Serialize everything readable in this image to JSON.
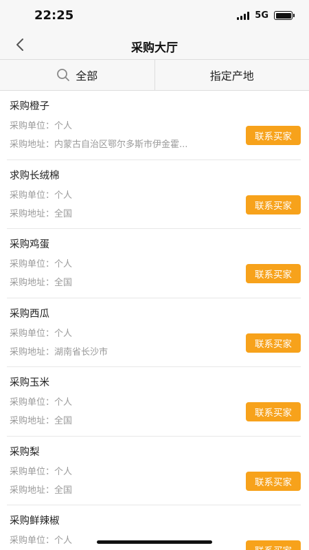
{
  "status": {
    "time": "22:25",
    "network": "5G"
  },
  "nav": {
    "title": "采购大厅",
    "back_icon": "chevron-left-icon"
  },
  "filters": {
    "all_label": "全部",
    "search_icon": "search-icon",
    "origin_label": "指定产地"
  },
  "items": [
    {
      "title": "采购橙子",
      "unit": "采购单位：个人",
      "address": "采购地址：内蒙古自治区鄂尔多斯市伊金霍...",
      "button": "联系买家"
    },
    {
      "title": "求购长绒棉",
      "unit": "采购单位：个人",
      "address": "采购地址：全国",
      "button": "联系买家"
    },
    {
      "title": "采购鸡蛋",
      "unit": "采购单位：个人",
      "address": "采购地址：全国",
      "button": "联系买家"
    },
    {
      "title": "采购西瓜",
      "unit": "采购单位：个人",
      "address": "采购地址：湖南省长沙市",
      "button": "联系买家"
    },
    {
      "title": "采购玉米",
      "unit": "采购单位：个人",
      "address": "采购地址：全国",
      "button": "联系买家"
    },
    {
      "title": "采购梨",
      "unit": "采购单位：个人",
      "address": "采购地址：全国",
      "button": "联系买家"
    },
    {
      "title": "采购鲜辣椒",
      "unit": "采购单位：个人",
      "address": "",
      "button": "联系买家"
    }
  ],
  "colors": {
    "accent": "#f7a21b",
    "secondary_text": "#9a9a9a",
    "bar_background": "#f7f7f7"
  }
}
